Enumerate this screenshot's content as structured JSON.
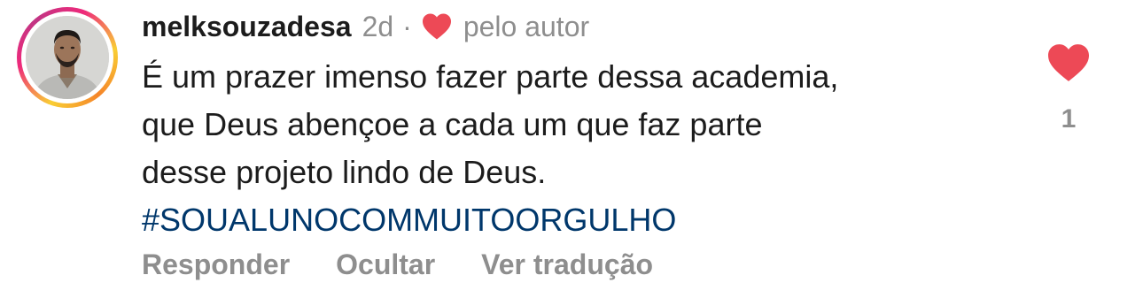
{
  "comment": {
    "username": "melksouzadesa",
    "timestamp": "2d",
    "separator": "·",
    "author_like_label": "pelo autor",
    "text_lines": [
      "É um prazer imenso fazer parte dessa academia,",
      "que Deus abençoe a cada um que faz parte",
      "desse projeto lindo de Deus."
    ],
    "hashtag": "#SOUALUNOCOMMUITOORGULHO",
    "actions": {
      "reply": "Responder",
      "hide": "Ocultar",
      "translate": "Ver tradução"
    },
    "like_count": "1",
    "liked": true
  },
  "icons": {
    "author_heart": "heart-icon",
    "like_heart": "heart-filled-icon",
    "avatar": "profile-photo"
  },
  "colors": {
    "heart": "#ed4956",
    "hashtag": "#00376b",
    "muted": "#8e8e8e",
    "text": "#1c1c1c"
  }
}
